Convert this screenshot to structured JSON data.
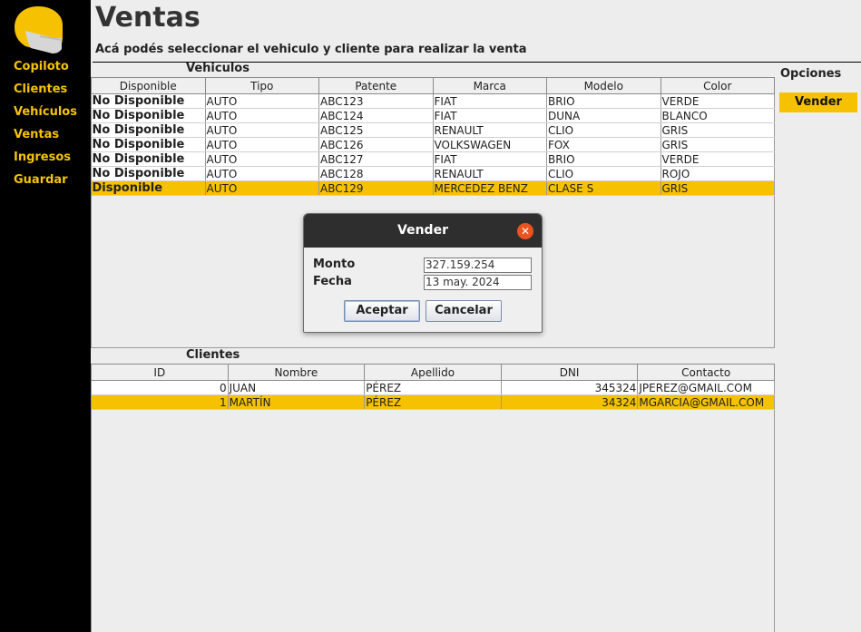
{
  "app": {
    "title": "Ventas",
    "subtitle": "Acá podés seleccionar el vehiculo y cliente para realizar la venta"
  },
  "sidebar": {
    "items": [
      {
        "label": "Copiloto"
      },
      {
        "label": "Clientes"
      },
      {
        "label": "Vehículos"
      },
      {
        "label": "Ventas"
      },
      {
        "label": "Ingresos"
      },
      {
        "label": "Guardar"
      }
    ]
  },
  "vehicles": {
    "title": "Vehiculos",
    "columns": [
      "Disponible",
      "Tipo",
      "Patente",
      "Marca",
      "Modelo",
      "Color"
    ],
    "rows": [
      [
        "No Disponible",
        "AUTO",
        "ABC123",
        "FIAT",
        "BRIO",
        "VERDE"
      ],
      [
        "No Disponible",
        "AUTO",
        "ABC124",
        "FIAT",
        "DUNA",
        "BLANCO"
      ],
      [
        "No Disponible",
        "AUTO",
        "ABC125",
        "RENAULT",
        "CLIO",
        "GRIS"
      ],
      [
        "No Disponible",
        "AUTO",
        "ABC126",
        "VOLKSWAGEN",
        "FOX",
        "GRIS"
      ],
      [
        "No Disponible",
        "AUTO",
        "ABC127",
        "FIAT",
        "BRIO",
        "VERDE"
      ],
      [
        "No Disponible",
        "AUTO",
        "ABC128",
        "RENAULT",
        "CLIO",
        "ROJO"
      ],
      [
        "Disponible",
        "AUTO",
        "ABC129",
        "MERCEDEZ BENZ",
        "CLASE S",
        "GRIS"
      ]
    ]
  },
  "clients": {
    "title": "Clientes",
    "columns": [
      "ID",
      "Nombre",
      "Apellido",
      "DNI",
      "Contacto"
    ],
    "rows": [
      [
        "0",
        "JUAN",
        "PÉREZ",
        "345324",
        "JPEREZ@GMAIL.COM"
      ],
      [
        "1",
        "MARTÍN",
        "PÉREZ",
        "34324",
        "MGARCIA@GMAIL.COM"
      ]
    ]
  },
  "options": {
    "title": "Opciones",
    "vender_label": "Vender"
  },
  "dialog": {
    "title": "Vender",
    "monto_label": "Monto",
    "monto_value": "327.159.254",
    "fecha_label": "Fecha",
    "fecha_value": "13 may. 2024",
    "accept_label": "Aceptar",
    "cancel_label": "Cancelar"
  },
  "colors": {
    "accent": "#f6c200",
    "sidebar_bg": "#000000",
    "close_button": "#e95420"
  }
}
